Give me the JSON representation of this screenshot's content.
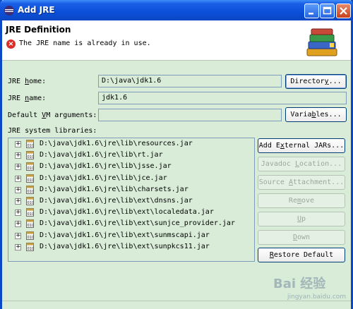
{
  "window": {
    "title": "Add JRE"
  },
  "header": {
    "title": "JRE Definition",
    "error_message": "The JRE name is already in use."
  },
  "form": {
    "jre_home": {
      "label_before": "JRE ",
      "label_mnemonic": "h",
      "label_after": "ome:",
      "value": "D:\\java\\jdk1.6"
    },
    "jre_name": {
      "label_before": "JRE ",
      "label_mnemonic": "n",
      "label_after": "ame:",
      "value": "jdk1.6"
    },
    "vm_args": {
      "label_before": "Default ",
      "label_mnemonic": "V",
      "label_after": "M arguments:",
      "value": ""
    },
    "libraries_label": "JRE system libraries:"
  },
  "buttons": {
    "directory": {
      "before": "Director",
      "mnemonic": "y",
      "after": "..."
    },
    "variables": {
      "before": "Varia",
      "mnemonic": "b",
      "after": "les..."
    },
    "add_external_jars": {
      "before": "Add E",
      "mnemonic": "x",
      "after": "ternal JARs..."
    },
    "javadoc_location": {
      "before": "Javadoc ",
      "mnemonic": "L",
      "after": "ocation..."
    },
    "source_attachment": {
      "before": "Source ",
      "mnemonic": "A",
      "after": "ttachment..."
    },
    "remove": {
      "before": "Re",
      "mnemonic": "m",
      "after": "ove"
    },
    "up": {
      "before": "",
      "mnemonic": "U",
      "after": "p"
    },
    "down": {
      "before": "",
      "mnemonic": "D",
      "after": "own"
    },
    "restore_default": {
      "before": "",
      "mnemonic": "R",
      "after": "estore Default"
    }
  },
  "libraries": [
    {
      "path": "D:\\java\\jdk1.6\\jre\\lib\\resources.jar"
    },
    {
      "path": "D:\\java\\jdk1.6\\jre\\lib\\rt.jar"
    },
    {
      "path": "D:\\java\\jdk1.6\\jre\\lib\\jsse.jar"
    },
    {
      "path": "D:\\java\\jdk1.6\\jre\\lib\\jce.jar"
    },
    {
      "path": "D:\\java\\jdk1.6\\jre\\lib\\charsets.jar"
    },
    {
      "path": "D:\\java\\jdk1.6\\jre\\lib\\ext\\dnsns.jar"
    },
    {
      "path": "D:\\java\\jdk1.6\\jre\\lib\\ext\\localedata.jar"
    },
    {
      "path": "D:\\java\\jdk1.6\\jre\\lib\\ext\\sunjce_provider.jar"
    },
    {
      "path": "D:\\java\\jdk1.6\\jre\\lib\\ext\\sunmscapi.jar"
    },
    {
      "path": "D:\\java\\jdk1.6\\jre\\lib\\ext\\sunpkcs11.jar"
    }
  ],
  "watermark": {
    "main": "Bai 经验",
    "sub": "jingyan.baidu.com"
  },
  "colors": {
    "titlebar": "#0b4fd8",
    "dialog_bg": "#d8ecd8",
    "error": "#d8302a"
  }
}
